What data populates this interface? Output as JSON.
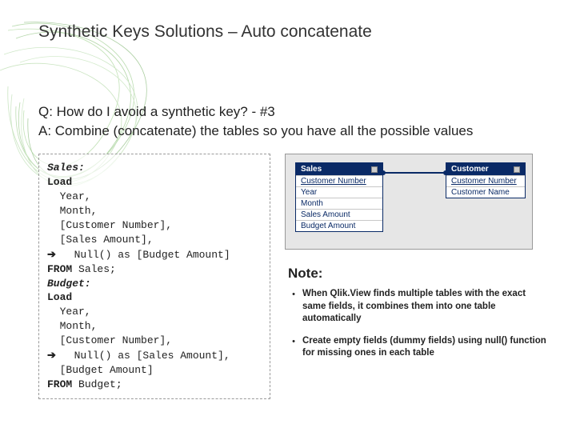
{
  "title": "Synthetic Keys Solutions – Auto concatenate",
  "qa": {
    "q": "Q: How do I avoid a synthetic key? - #3",
    "a": "A: Combine (concatenate) the tables so you have all the possible values"
  },
  "code": {
    "l1": "Sales:",
    "l2": "Load",
    "l3": "  Year,",
    "l4": "  Month,",
    "l5": "  [Customer Number],",
    "l6": "  [Sales Amount],",
    "l7": "  Null() as [Budget Amount]",
    "l8a": "FROM",
    "l8b": " Sales;",
    "l9": "Budget:",
    "l10": "Load",
    "l11": "  Year,",
    "l12": "  Month,",
    "l13": "  [Customer Number],",
    "l14": "  Null() as [Sales Amount],",
    "l15": "  [Budget Amount]",
    "l16a": "FROM",
    "l16b": " Budget;",
    "arrow": "➔"
  },
  "diagram": {
    "sales": {
      "title": "Sales",
      "fields": [
        "Customer Number",
        "Year",
        "Month",
        "Sales Amount",
        "Budget Amount"
      ]
    },
    "customer": {
      "title": "Customer",
      "fields": [
        "Customer Number",
        "Customer Name"
      ]
    }
  },
  "notes": {
    "heading": "Note:",
    "items": [
      "When Qlik.View finds multiple tables with the exact same fields, it combines them into one table automatically",
      "Create empty fields (dummy fields) using null() function for missing ones in each table"
    ],
    "bullet": "•"
  }
}
